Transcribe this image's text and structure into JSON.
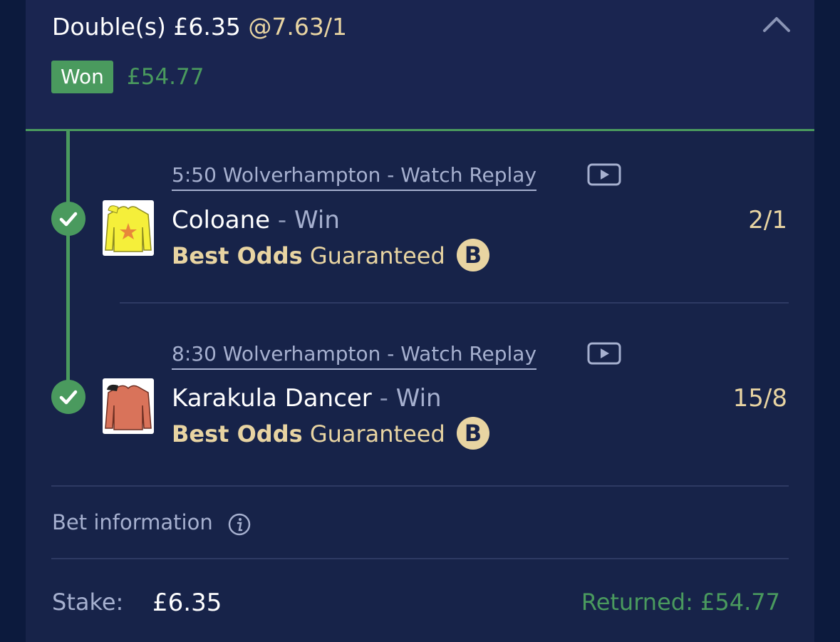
{
  "bet": {
    "title": "Double(s) £6.35",
    "odds": "@7.63/1",
    "status": "Won",
    "winnings": "£54.77"
  },
  "selections": [
    {
      "race": "5:50 Wolverhampton - Watch Replay",
      "horse": "Coloane",
      "separator": "-",
      "market": "Win",
      "price": "2/1",
      "bog_bold": "Best Odds",
      "bog_rest": "Guaranteed",
      "bog_icon": "B",
      "silk_color": "#f5ef3a"
    },
    {
      "race": "8:30 Wolverhampton - Watch Replay",
      "horse": "Karakula Dancer",
      "separator": "-",
      "market": "Win",
      "price": "15/8",
      "bog_bold": "Best Odds",
      "bog_rest": "Guaranteed",
      "bog_icon": "B",
      "silk_color": "#d9735a"
    }
  ],
  "info": {
    "label": "Bet information"
  },
  "footer": {
    "stake_label": "Stake:",
    "stake_value": "£6.35",
    "returned": "Returned: £54.77"
  },
  "colors": {
    "accent_green": "#4a9a5e",
    "gold": "#e8d4a2",
    "background": "#172349"
  },
  "icons": [
    "chevron-up-icon",
    "check-icon",
    "play-icon",
    "jockey-silk-icon",
    "bog-badge-icon",
    "info-icon"
  ]
}
